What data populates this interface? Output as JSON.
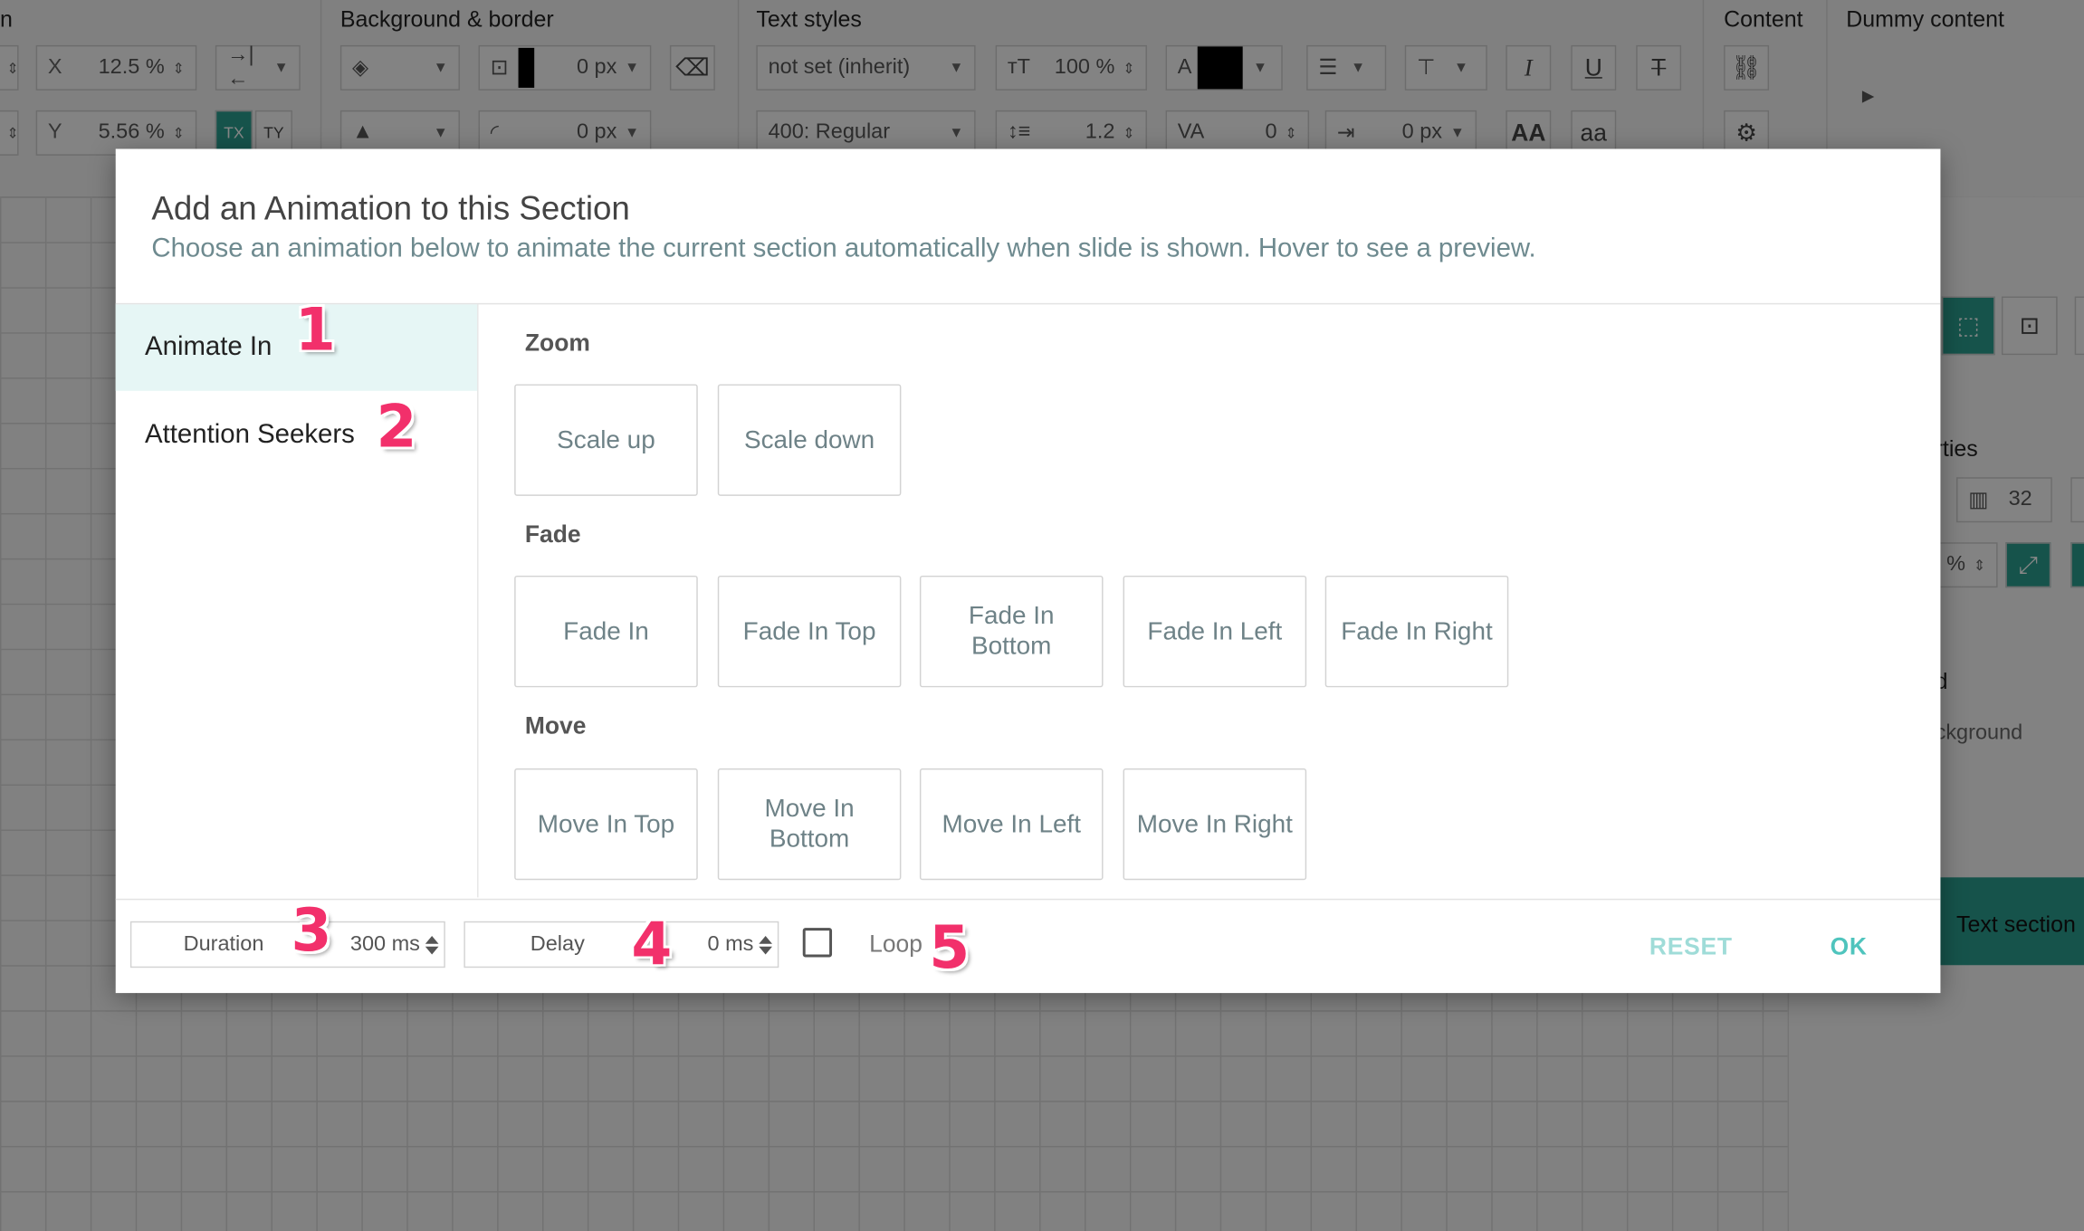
{
  "toolbar": {
    "groups": {
      "left_partial": "n",
      "background_border": "Background & border",
      "text_styles": "Text styles",
      "content": "Content",
      "dummy_content": "Dummy content"
    },
    "x_label": "X",
    "x_value": "12.5 %",
    "y_label": "Y",
    "y_value": "5.56 %",
    "border_width_1": "0 px",
    "border_width_2": "0 px",
    "font_family": "not set (inherit)",
    "font_weight": "400: Regular",
    "font_size": "100 %",
    "line_height": "1.2",
    "letter_spacing": "0",
    "word_spacing": "0 px"
  },
  "right_panel": {
    "properties_partial": "rties",
    "columns_value": "32",
    "d_partial": "d",
    "background_partial": "ckground",
    "text_section": "Text section"
  },
  "modal": {
    "title": "Add an Animation to this Section",
    "subtitle": "Choose an animation below to animate the current section automatically when slide is shown. Hover to see a preview.",
    "sidebar": [
      {
        "label": "Animate In",
        "active": true
      },
      {
        "label": "Attention Seekers",
        "active": false
      }
    ],
    "sections": {
      "zoom": {
        "label": "Zoom",
        "items": [
          "Scale up",
          "Scale down"
        ]
      },
      "fade": {
        "label": "Fade",
        "items": [
          "Fade In",
          "Fade In Top",
          "Fade In Bottom",
          "Fade In Left",
          "Fade In Right"
        ]
      },
      "move": {
        "label": "Move",
        "items": [
          "Move In Top",
          "Move In Bottom",
          "Move In Left",
          "Move In Right"
        ]
      }
    },
    "footer": {
      "duration_label": "Duration",
      "duration_value": "300 ms",
      "delay_label": "Delay",
      "delay_value": "0 ms",
      "loop_label": "Loop",
      "loop_checked": false,
      "reset_label": "RESET",
      "ok_label": "OK"
    },
    "accent_color": "#4fc4bd"
  },
  "annotations": [
    "1",
    "2",
    "3",
    "4",
    "5"
  ]
}
